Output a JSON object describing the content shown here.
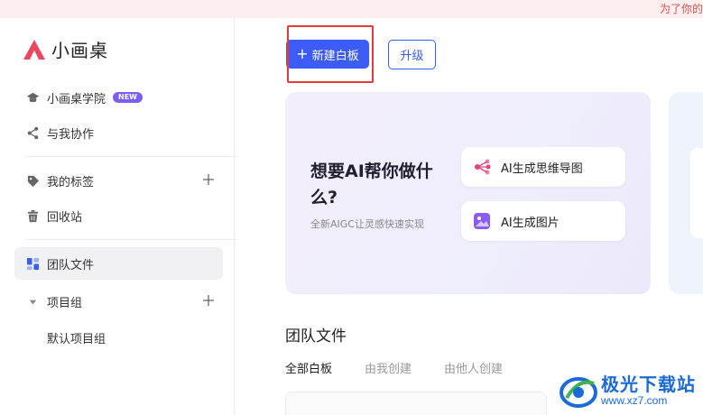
{
  "banner": {
    "text": "为了你的"
  },
  "app": {
    "name": "小画桌"
  },
  "sidebar": {
    "academy": {
      "label": "小画桌学院",
      "badge": "NEW"
    },
    "collab": {
      "label": "与我协作"
    },
    "tags": {
      "label": "我的标签"
    },
    "trash": {
      "label": "回收站"
    },
    "team": {
      "label": "团队文件"
    },
    "projects": {
      "label": "项目组",
      "children": [
        "默认项目组"
      ]
    }
  },
  "toolbar": {
    "new_label": "新建白板",
    "new_icon": "+",
    "upgrade_label": "升级"
  },
  "ai_card": {
    "title": "想要AI帮你做什么?",
    "subtitle": "全新AIGC让灵感快速实现",
    "options": [
      {
        "label": "AI生成思维导图",
        "icon": "mindmap-icon"
      },
      {
        "label": "AI生成图片",
        "icon": "image-icon"
      }
    ]
  },
  "files": {
    "title": "团队文件",
    "tabs": [
      "全部白板",
      "由我创建",
      "由他人创建"
    ],
    "active_tab": 0
  },
  "watermark": {
    "name": "极光下载站",
    "url": "www.xz7.com"
  },
  "colors": {
    "accent": "#3d5cf5",
    "badge": "#7b5cf5",
    "highlight": "#e23b3b",
    "logo": "#e8475f"
  }
}
